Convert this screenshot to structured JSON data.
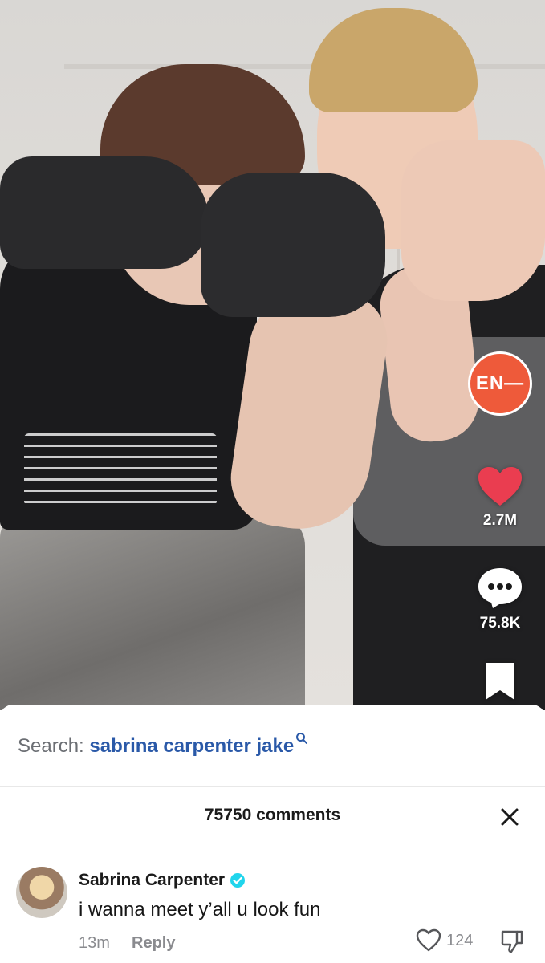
{
  "video": {
    "creator_badge": "EN—",
    "likes": "2.7M",
    "comments": "75.8K",
    "icons": [
      "heart-icon",
      "comment-bubble-icon",
      "bookmark-icon"
    ],
    "colors": {
      "like_heart": "#ea3d50",
      "badge_bg": "#ee5a3a"
    }
  },
  "search": {
    "prefix": "Search:",
    "query": "sabrina carpenter jake",
    "query_color": "#2a59a8"
  },
  "comments_panel": {
    "title": "75750 comments",
    "comment": {
      "author": "Sabrina Carpenter",
      "verified": true,
      "text": "i wanna meet y’all u look fun",
      "time": "13m",
      "reply_label": "Reply",
      "likes": "124"
    }
  }
}
